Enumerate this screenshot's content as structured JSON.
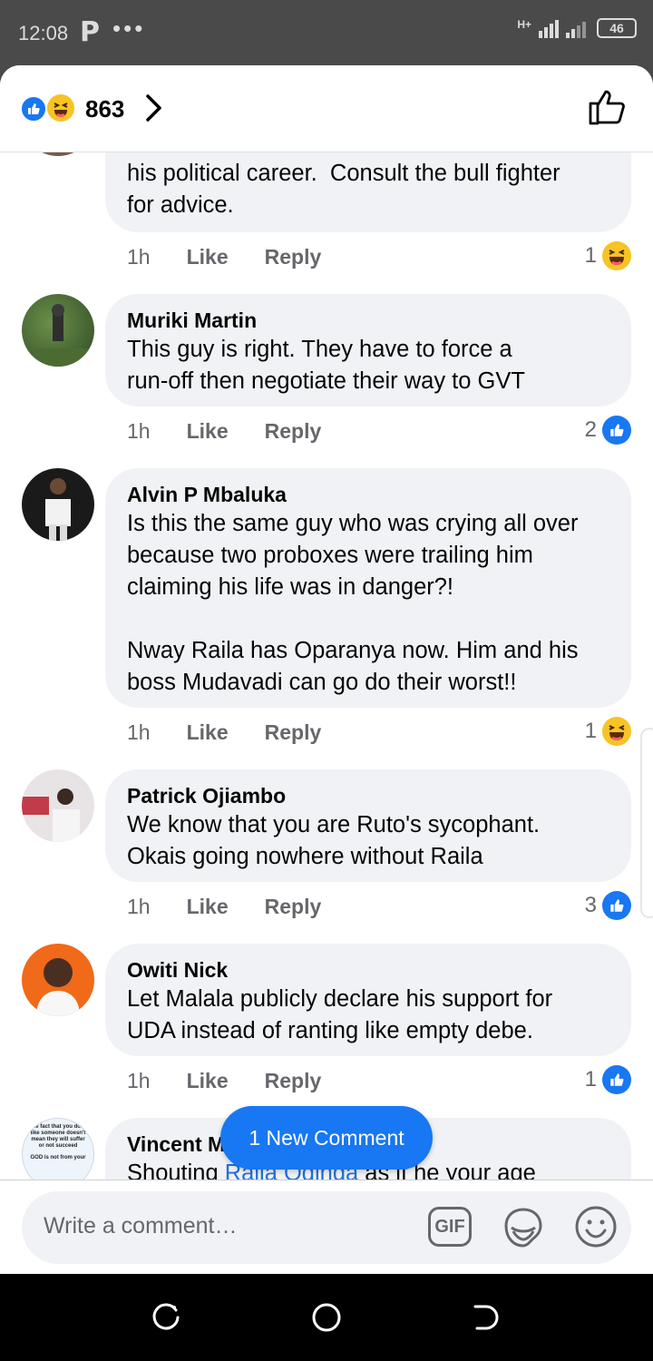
{
  "status": {
    "time": "12:08",
    "app_letter": "P",
    "dots": "•••",
    "network": "H+",
    "battery": "46"
  },
  "reactions": {
    "count": "863"
  },
  "comments": [
    {
      "author": "",
      "text": "his political career.  Consult the bull fighter\nfor advice.",
      "time": "1h",
      "like": "Like",
      "reply": "Reply",
      "reaction_count": "1",
      "reaction": "haha"
    },
    {
      "author": "Muriki Martin",
      "text": "This guy is right. They have to force a\nrun-off then negotiate their way to GVT",
      "time": "1h",
      "like": "Like",
      "reply": "Reply",
      "reaction_count": "2",
      "reaction": "like"
    },
    {
      "author": "Alvin P Mbaluka",
      "text": "Is this the same guy who was crying all over\nbecause two proboxes were trailing him\nclaiming his life was in danger?!\n\nNway Raila has Oparanya now. Him and his\nboss Mudavadi can go do their worst!!",
      "time": "1h",
      "like": "Like",
      "reply": "Reply",
      "reaction_count": "1",
      "reaction": "haha"
    },
    {
      "author": "Patrick Ojiambo",
      "text": "We know that you are Ruto's sycophant.\nOkais going nowhere without Raila",
      "time": "1h",
      "like": "Like",
      "reply": "Reply",
      "reaction_count": "3",
      "reaction": "like"
    },
    {
      "author": "Owiti Nick",
      "text": "Let Malala publicly declare his support for\nUDA instead of ranting like empty debe.",
      "time": "1h",
      "like": "Like",
      "reply": "Reply",
      "reaction_count": "1",
      "reaction": "like"
    },
    {
      "author": "Vincent M",
      "text_before": "Shouting ",
      "text_link": "Raila Odinga",
      "text_after": " as if he your age",
      "avatar_text": "The fact that you don't like someone doesn't mean they will suffer or not succeed",
      "avatar_text2": "GOD is not from your"
    }
  ],
  "new_comment_label": "1 New Comment",
  "composer": {
    "placeholder": "Write a comment…",
    "gif_label": "GIF"
  },
  "colors": {
    "accent": "#1877f2",
    "bubble": "#f0f2f5",
    "muted_text": "#65676b",
    "haha": "#f7c325"
  }
}
